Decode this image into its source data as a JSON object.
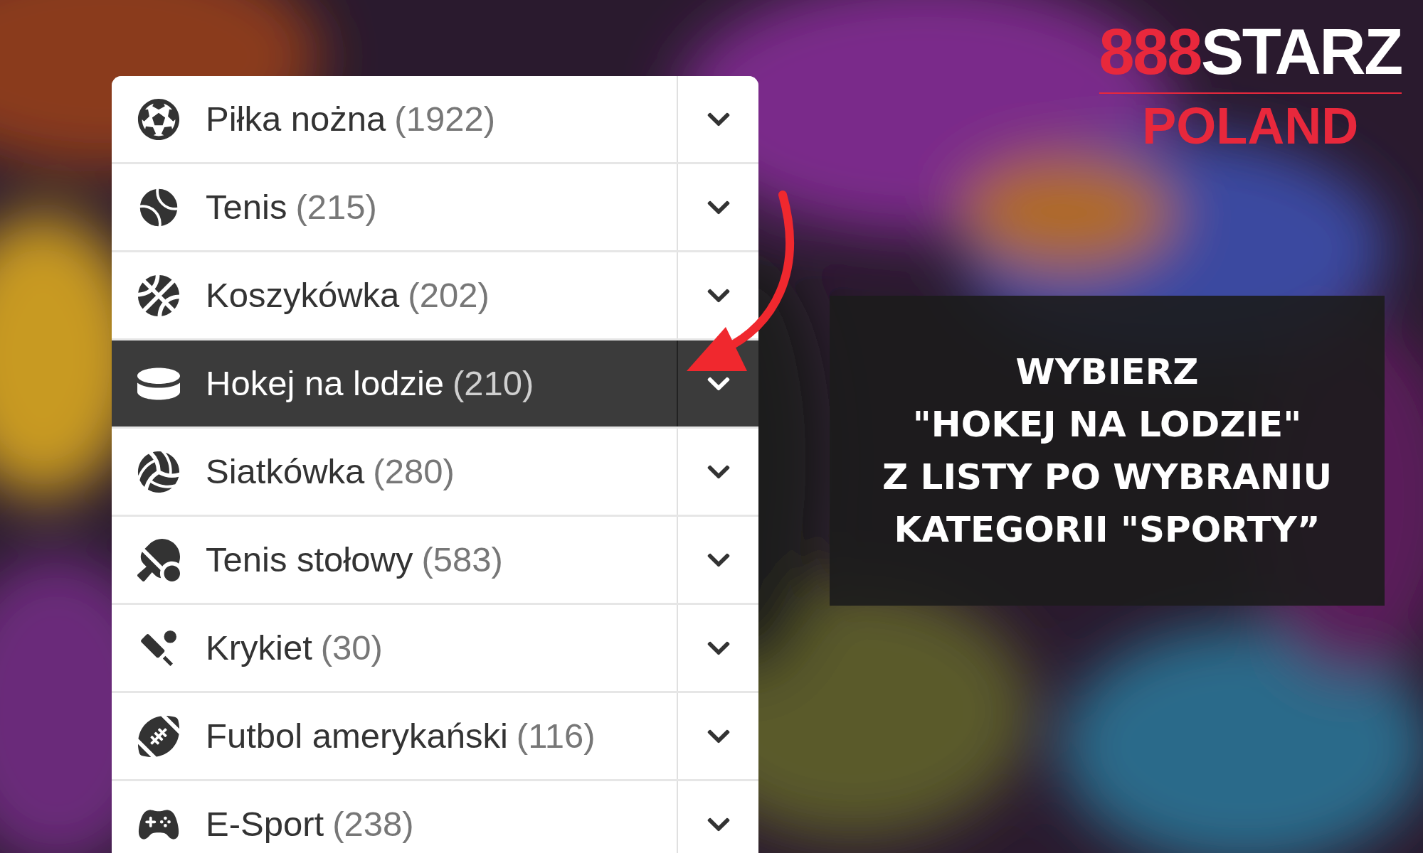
{
  "logo": {
    "brand_number": "888",
    "brand_word": "STARZ",
    "country": "POLAND"
  },
  "sports": [
    {
      "name": "Piłka nożna",
      "count": "(1922)",
      "selected": false
    },
    {
      "name": "Tenis",
      "count": "(215)",
      "selected": false
    },
    {
      "name": "Koszykówka",
      "count": "(202)",
      "selected": false
    },
    {
      "name": "Hokej na lodzie",
      "count": "(210)",
      "selected": true
    },
    {
      "name": "Siatkówka",
      "count": "(280)",
      "selected": false
    },
    {
      "name": "Tenis stołowy",
      "count": "(583)",
      "selected": false
    },
    {
      "name": "Krykiet",
      "count": "(30)",
      "selected": false
    },
    {
      "name": "Futbol amerykański",
      "count": "(116)",
      "selected": false
    },
    {
      "name": "E-Sport",
      "count": "(238)",
      "selected": false
    }
  ],
  "instruction": {
    "lines": [
      "WYBIERZ",
      "\"HOKEJ NA LODZIE\"",
      "Z LISTY PO WYBRANIU",
      "KATEGORII \"SPORTY”"
    ]
  }
}
